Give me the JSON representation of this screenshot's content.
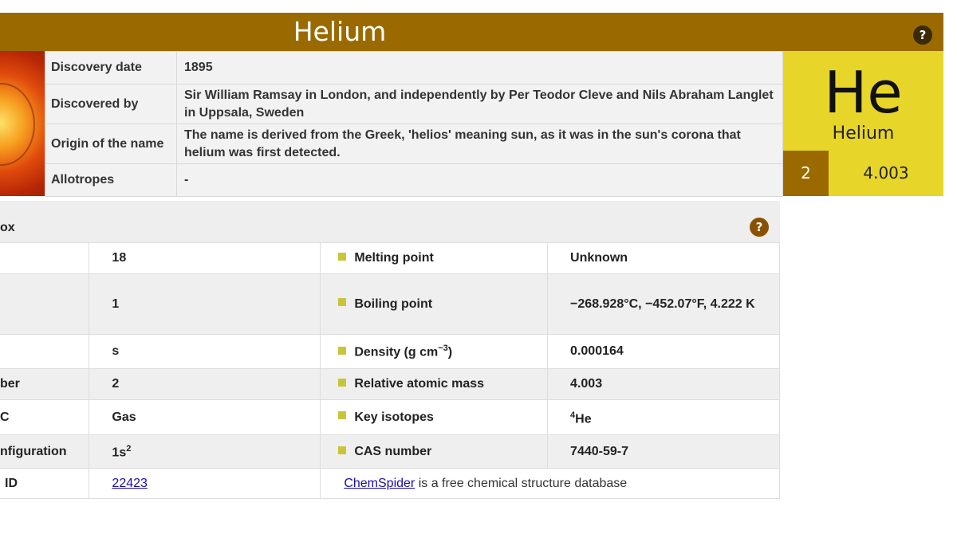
{
  "title": "Helium",
  "help_symbol": "?",
  "info_rows": [
    {
      "label": "Discovery date",
      "value": "1895"
    },
    {
      "label": "Discovered by",
      "value": "Sir William Ramsay in London, and independently by Per Teodor Cleve and Nils Abraham Langlet in Uppsala, Sweden"
    },
    {
      "label": "Origin of the name",
      "value": "The name is derived from the Greek, 'helios' meaning sun, as it was in the sun's corona that helium was first detected."
    },
    {
      "label": "Allotropes",
      "value": "-"
    }
  ],
  "tile": {
    "symbol": "He",
    "name": "Helium",
    "atomic_number": "2",
    "mass": "4.003"
  },
  "fact_box": {
    "title": "ox",
    "rows": [
      {
        "left_label": "",
        "left_value": "18",
        "right_label": "Melting point",
        "right_value": "Unknown"
      },
      {
        "left_label": "",
        "left_value": "1",
        "right_label": "Boiling point",
        "right_value": "−268.928°C, −452.07°F, 4.222 K"
      },
      {
        "left_label": "",
        "left_value": "s",
        "right_label": "Density (g cm",
        "right_label_sup": "−3",
        "right_label_tail": ")",
        "right_value": "0.000164"
      },
      {
        "left_label": "ber",
        "left_value": "2",
        "right_label": "Relative atomic mass",
        "right_value": "4.003"
      },
      {
        "left_label": "C",
        "left_value": "Gas",
        "right_label": "Key isotopes",
        "right_value_sup": "4",
        "right_value": "He"
      },
      {
        "left_label": "nfiguration",
        "left_value_base": "1s",
        "left_value_sup": "2",
        "right_label": "CAS number",
        "right_value": "7440-59-7"
      }
    ],
    "chemspider": {
      "label": "ID",
      "id": "22423",
      "link_text": "ChemSpider",
      "note": " is a free chemical structure database"
    }
  },
  "colors": {
    "brand_brown": "#9a6a00",
    "tile_yellow": "#e8d52a",
    "bullet": "#c9c43a",
    "link": "#1a0dab"
  }
}
